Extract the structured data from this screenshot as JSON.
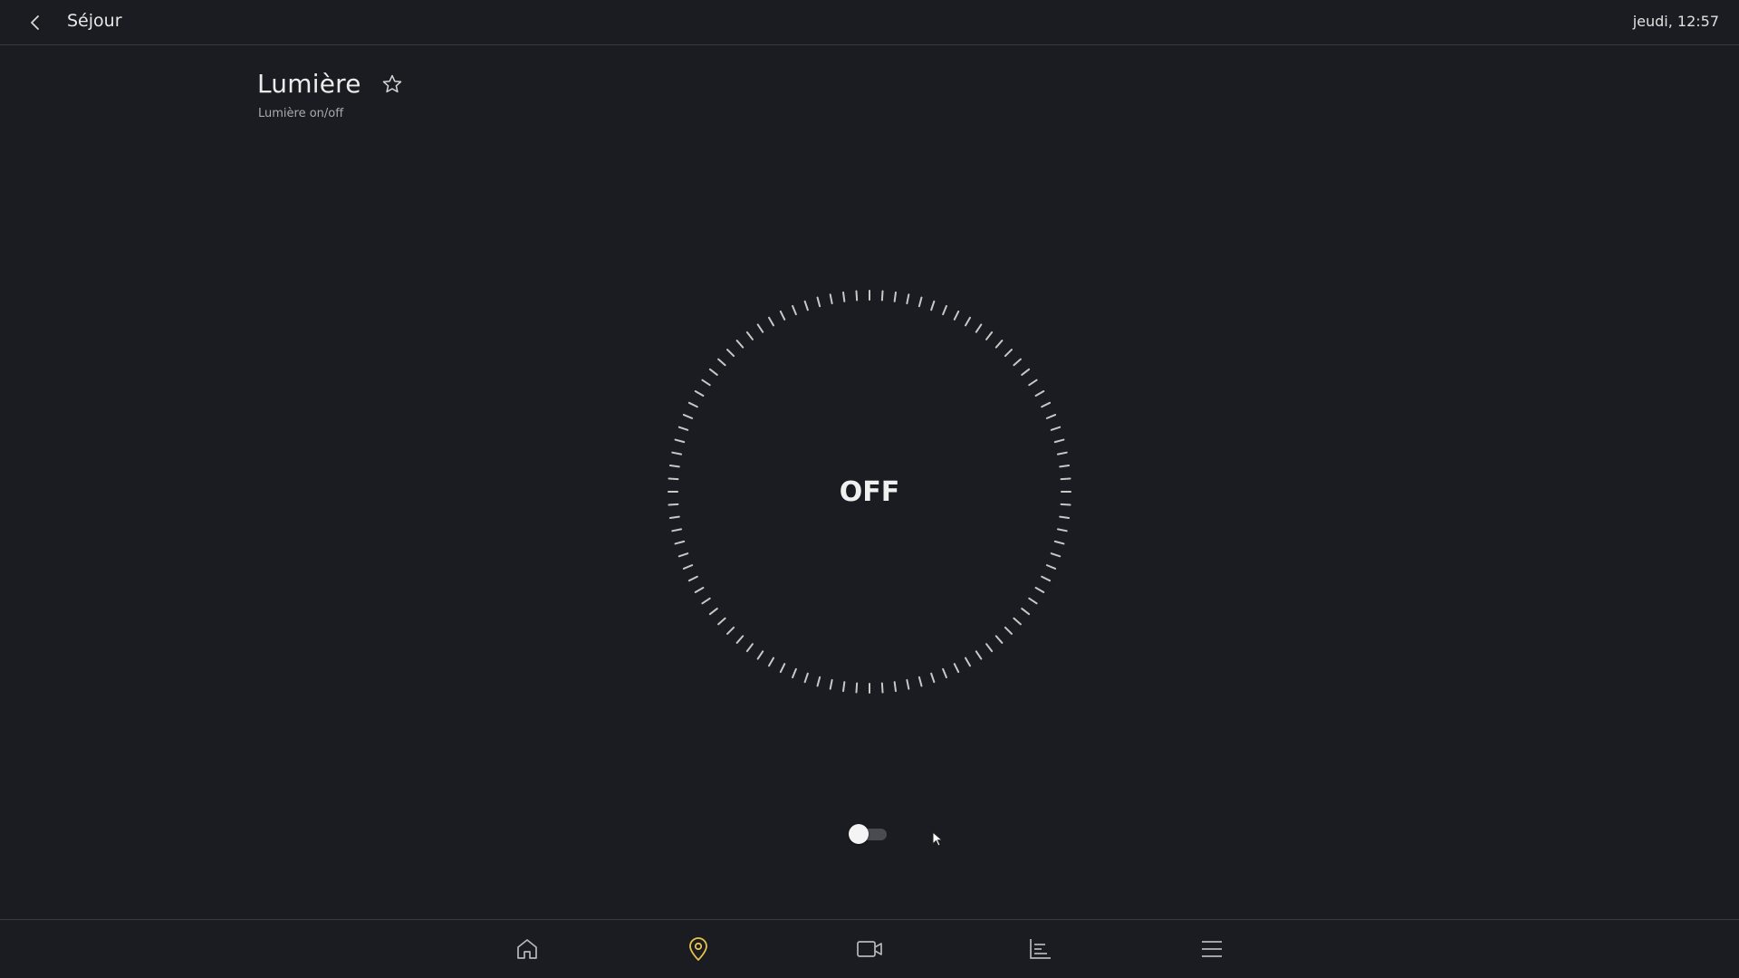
{
  "topbar": {
    "room_title": "Séjour",
    "datetime": "jeudi, 12:57",
    "back_icon": "chevron-left-icon"
  },
  "device": {
    "title": "Lumière",
    "subtitle": "Lumière on/off",
    "favorite_icon": "star-outline-icon",
    "favorite": false
  },
  "dial": {
    "state_label": "OFF",
    "tick_color": "#c8c8c8"
  },
  "toggle": {
    "on": false,
    "knob_color": "#f4f4f4",
    "track_color": "#4a4b51"
  },
  "bottom_nav": {
    "items": [
      {
        "name": "home",
        "icon": "home-icon",
        "active": false
      },
      {
        "name": "location",
        "icon": "map-pin-icon",
        "active": true
      },
      {
        "name": "camera",
        "icon": "video-camera-icon",
        "active": false
      },
      {
        "name": "statistics",
        "icon": "chart-icon",
        "active": false
      },
      {
        "name": "menu",
        "icon": "hamburger-menu-icon",
        "active": false
      }
    ],
    "active_color": "#e8c34a",
    "inactive_color": "#b8b8bc"
  },
  "colors": {
    "background": "#1b1c21",
    "divider": "#3a3b40",
    "text": "#e6e6e6"
  }
}
